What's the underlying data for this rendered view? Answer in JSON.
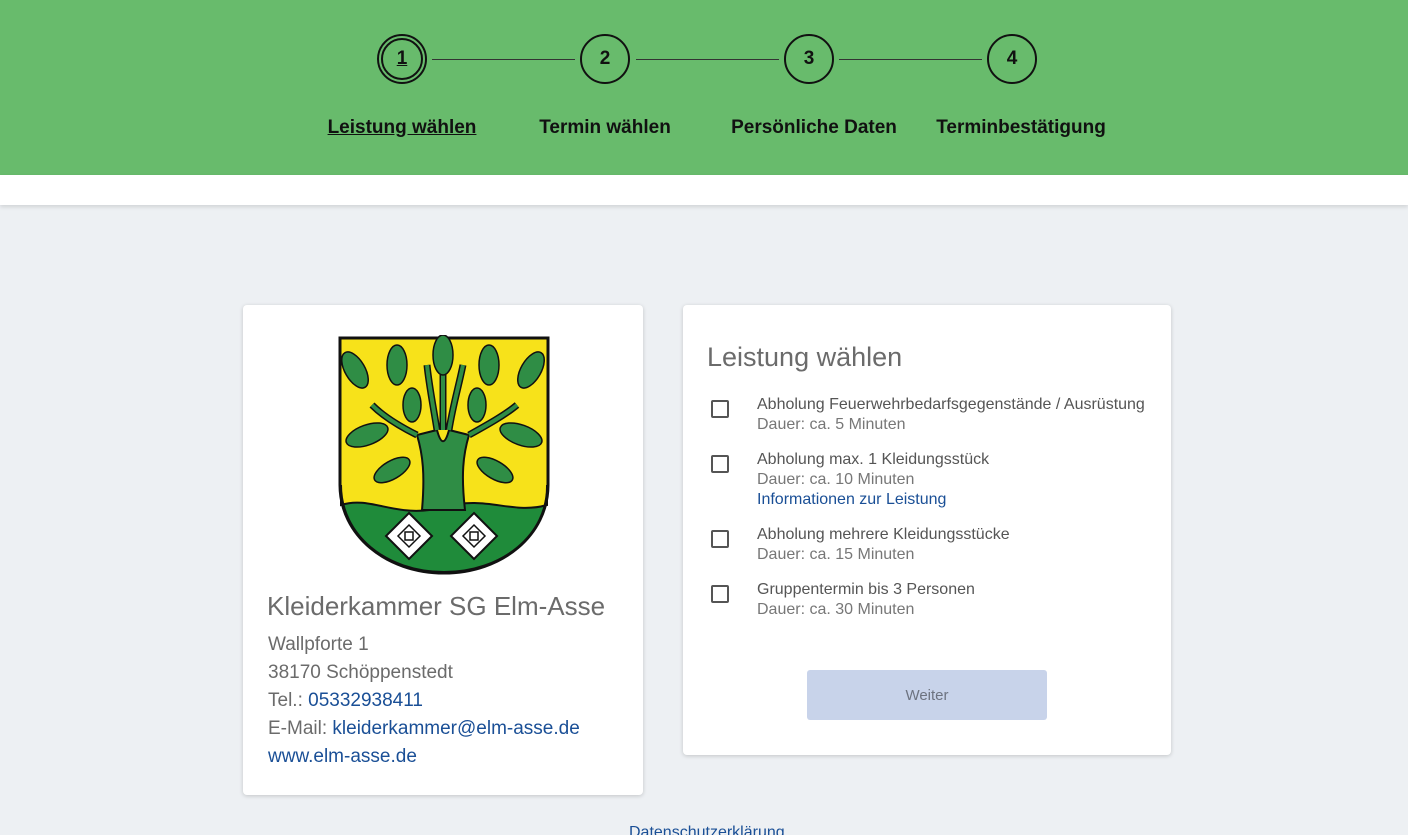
{
  "stepper": {
    "steps": [
      {
        "number": "1",
        "label": "Leistung wählen",
        "active": true
      },
      {
        "number": "2",
        "label": "Termin wählen",
        "active": false
      },
      {
        "number": "3",
        "label": "Persönliche Daten",
        "active": false
      },
      {
        "number": "4",
        "label": "Terminbestätigung",
        "active": false
      }
    ]
  },
  "organization": {
    "name": "Kleiderkammer SG Elm-Asse",
    "street": "Wallpforte 1",
    "city": "38170 Schöppenstedt",
    "phone_label": "Tel.:",
    "phone": "05332938411",
    "email_label": "E-Mail:",
    "email": "kleiderkammer@elm-asse.de",
    "website": "www.elm-asse.de"
  },
  "services": {
    "title": "Leistung wählen",
    "items": [
      {
        "name": "Abholung Feuerwehrbedarfsgegenstände / Ausrüstung",
        "duration": "Dauer: ca. 5 Minuten",
        "checked": false
      },
      {
        "name": "Abholung max. 1 Kleidungsstück",
        "duration": "Dauer: ca. 10 Minuten",
        "info": "Informationen zur Leistung",
        "checked": false
      },
      {
        "name": "Abholung mehrere Kleidungsstücke",
        "duration": "Dauer: ca. 15 Minuten",
        "checked": false
      },
      {
        "name": "Gruppentermin bis 3 Personen",
        "duration": "Dauer: ca. 30 Minuten",
        "checked": false
      }
    ],
    "next_label": "Weiter",
    "next_enabled": false
  },
  "footer": {
    "privacy_label": "Datenschutzerklärung"
  },
  "colors": {
    "header": "#68bb6c",
    "link": "#1a4f96",
    "button_disabled": "#c8d3ea"
  }
}
